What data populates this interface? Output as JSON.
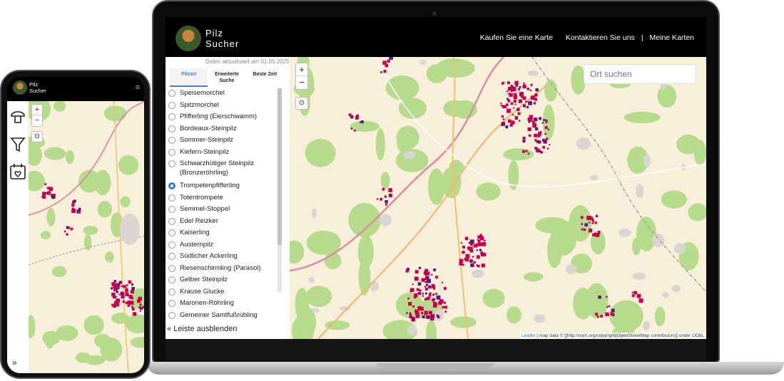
{
  "colors": {
    "background": "#ffffff",
    "header": "#000000",
    "accent": "#3a86d4",
    "forest": "#b6db8c",
    "mushroom_spot": "#c8004e",
    "mushroom_dense": "#5a1a7a"
  },
  "header": {
    "brand_line1": "Pilz",
    "brand_line2": "Sucher",
    "nav": [
      "Kaufen Sie eine Karte",
      "Kontaktieren Sie uns",
      "Meine Karten"
    ]
  },
  "sidebar": {
    "updated": "Daten aktualisiert am 01.05.2025",
    "tabs": [
      {
        "label": "Pilzart",
        "active": true
      },
      {
        "label": "Erweiterte Suche",
        "active": false
      },
      {
        "label": "Beste Zeit",
        "active": false
      }
    ],
    "species": [
      {
        "label": "Speisemorchel",
        "selected": false
      },
      {
        "label": "Spitzmorchel",
        "selected": false
      },
      {
        "label": "Pfifferling (Eierschwamm)",
        "selected": false
      },
      {
        "label": "Bordeaux-Steinpilz",
        "selected": false
      },
      {
        "label": "Sommer-Steinpilz",
        "selected": false
      },
      {
        "label": "Kiefern-Steinpilz",
        "selected": false
      },
      {
        "label": "Schwarzhütiger Steinpilz (Bronzeröhrling)",
        "selected": false
      },
      {
        "label": "Trompetenpfifferling",
        "selected": true
      },
      {
        "label": "Totentrompete",
        "selected": false
      },
      {
        "label": "Semmel-Stoppel",
        "selected": false
      },
      {
        "label": "Edel Reizker",
        "selected": false
      },
      {
        "label": "Kaiserling",
        "selected": false
      },
      {
        "label": "Austernpilz",
        "selected": false
      },
      {
        "label": "Südlicher Ackerling",
        "selected": false
      },
      {
        "label": "Riesenschirmling (Parasol)",
        "selected": false
      },
      {
        "label": "Gelber Steinpilz",
        "selected": false
      },
      {
        "label": "Krause Glucke",
        "selected": false
      },
      {
        "label": "Maronen-Röhrling",
        "selected": false
      },
      {
        "label": "Gemeiner Samtfußrübling",
        "selected": false
      }
    ],
    "hide_label": "Leiste ausblenden",
    "hide_icon": "double-chevron-left-icon"
  },
  "map": {
    "zoom_in": "+",
    "zoom_out": "−",
    "search_placeholder": "Ort suchen",
    "attribution_leaflet": "Leaflet",
    "attribution_rest": " | map data © [[http://osm.org/copyright|OpenStreetMap contributors]] under ODbL"
  },
  "phone": {
    "brand_line1": "Pilz",
    "brand_line2": "Sucher",
    "menu_icon": "hamburger-icon",
    "side_icons": [
      "mushroom-icon",
      "filter-icon",
      "calendar-heart-icon"
    ],
    "expand_icon": "double-chevron-right-icon"
  }
}
